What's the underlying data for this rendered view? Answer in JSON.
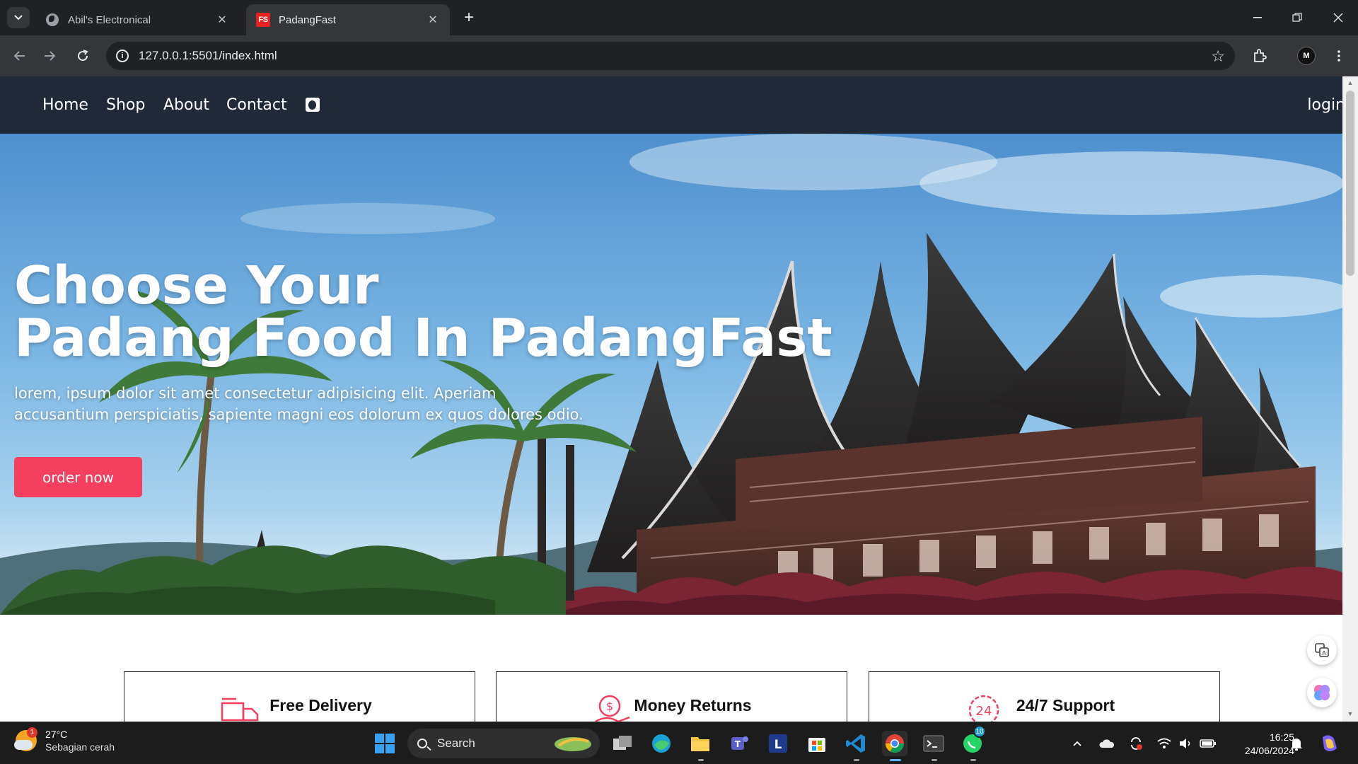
{
  "browser": {
    "tabs": [
      {
        "title": "Abil's Electronical",
        "active": false,
        "icon": "globe-icon"
      },
      {
        "title": "PadangFast",
        "active": true,
        "icon": "fs-favicon",
        "favicon_text": "FS"
      }
    ],
    "new_tab_symbol": "+",
    "url": "127.0.0.1:5501/index.html",
    "profile_initial": "M"
  },
  "site": {
    "nav": {
      "links": [
        "Home",
        "Shop",
        "About",
        "Contact"
      ],
      "login": "login"
    },
    "hero": {
      "title_line1": "Choose Your",
      "title_line2": "Padang Food In PadangFast",
      "subtitle": "lorem, ipsum dolor sit amet consectetur adipisicing elit. Aperiam accusantium perspiciatis, sapiente magni eos dolorum ex quos dolores odio.",
      "cta": "order now"
    },
    "features": [
      {
        "title": "Free Delivery",
        "icon": "delivery-truck-icon"
      },
      {
        "title": "Money Returns",
        "icon": "money-return-icon"
      },
      {
        "title": "24/7 Support",
        "icon": "support-24-icon",
        "icon_text": "24"
      }
    ]
  },
  "taskbar": {
    "weather_temp": "27°C",
    "weather_desc": "Sebagian cerah",
    "weather_badge": "1",
    "search_label": "Search",
    "pinned": [
      "task-view-icon",
      "edge-icon",
      "file-explorer-icon",
      "teams-icon",
      "l-app-icon",
      "store-icon",
      "vscode-icon",
      "chrome-icon",
      "terminal-icon",
      "whatsapp-icon"
    ],
    "whatsapp_badge": "10",
    "time": "16:25",
    "date": "24/06/2024"
  },
  "colors": {
    "navbar": "#1f2937",
    "accent": "#f43f5e",
    "chrome_dark": "#202124",
    "chrome_toolbar": "#35363a"
  }
}
